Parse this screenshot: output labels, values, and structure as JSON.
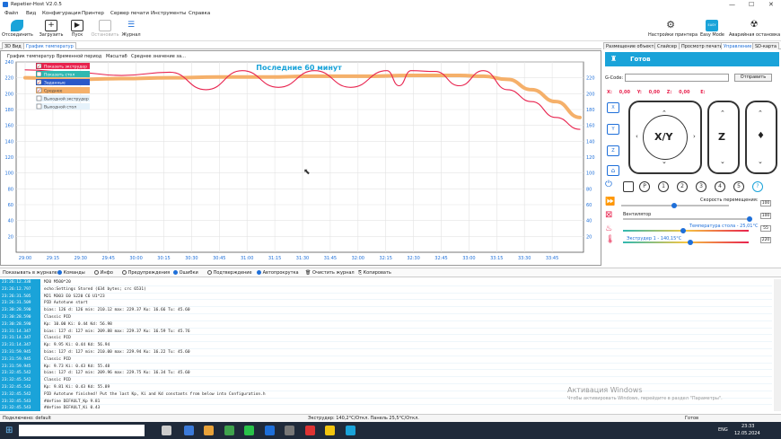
{
  "window": {
    "title": "Repetier-Host V2.0.5"
  },
  "menu": [
    "Файл",
    "Вид",
    "Конфигурация",
    "Принтер",
    "Сервер печати",
    "Инструменты",
    "Справка"
  ],
  "toolbar": {
    "left": [
      "Отсоединить",
      "Загрузить",
      "Пуск",
      "Остановить",
      "Журнал"
    ],
    "right": [
      "Настройки принтера",
      "Easy Mode",
      "Аварийная остановка"
    ],
    "easy_badge": "EASY"
  },
  "view_tabs": [
    "3D Вид",
    "График температур"
  ],
  "chart_toolbar": [
    "График температур",
    "Временной период",
    "Масштаб",
    "Среднее значение за..."
  ],
  "right_tabs": [
    "Размещение объекта",
    "Слайсер",
    "Просмотр печати",
    "Управление",
    "SD-карта"
  ],
  "chart_data": {
    "type": "line",
    "title": "Последние 60 минут",
    "x_ticks": [
      "29:00",
      "29:15",
      "29:30",
      "29:45",
      "30:00",
      "30:15",
      "30:30",
      "30:45",
      "31:00",
      "31:15",
      "31:30",
      "31:45",
      "32:00",
      "32:15",
      "32:30",
      "32:45",
      "33:00",
      "33:15",
      "33:30",
      "33:45"
    ],
    "y_ticks_left": [
      "240",
      "220",
      "200",
      "180",
      "160",
      "140",
      "120",
      "100",
      "80",
      "60",
      "40",
      "20"
    ],
    "y_ticks_right": [
      "220",
      "200",
      "180",
      "160",
      "140",
      "120",
      "100",
      "80",
      "60",
      "40",
      "20"
    ],
    "ylim": [
      0,
      240
    ],
    "grid": true,
    "legend_placement": "top-left",
    "legend": [
      "Показать экструдер",
      "Показать стол",
      "Заданные",
      "Среднее",
      "Выходной экструдер",
      "Выходной стол"
    ],
    "series": [
      {
        "name": "Экструдер",
        "color": "#e8234e",
        "x": [
          0,
          2,
          4,
          6,
          7.5,
          9,
          10.5,
          12,
          13.5,
          15,
          15.5,
          16,
          17,
          18,
          19,
          20,
          21,
          22,
          23
        ],
        "y": [
          230,
          227,
          223,
          227,
          205,
          229,
          208,
          229,
          208,
          229,
          210,
          229,
          228,
          210,
          229,
          205,
          190,
          170,
          155
        ]
      },
      {
        "name": "Среднее",
        "color": "#f5b06a",
        "x": [
          0,
          2,
          4,
          6,
          8,
          10,
          12,
          14,
          16,
          18,
          19,
          20,
          21,
          22,
          23
        ],
        "y": [
          220,
          218,
          219,
          220,
          221,
          221,
          222,
          222,
          223,
          223,
          222,
          218,
          205,
          190,
          170
        ]
      }
    ]
  },
  "control": {
    "status": "Готов",
    "gcode_label": "G-Code:",
    "send_button": "Отправить",
    "coords": {
      "x_label": "X:",
      "x": "0,00",
      "y_label": "Y:",
      "y": "0,00",
      "z_label": "Z:",
      "z": "0,00",
      "e_label": "E:"
    },
    "jog": {
      "xy": "X/Y",
      "z": "Z"
    },
    "home_buttons": [
      "X",
      "Y",
      "Z"
    ],
    "extruder_buttons": [
      "P",
      "1",
      "2",
      "3",
      "4",
      "5",
      "?"
    ],
    "speed_label": "Скорость перемещения:",
    "speed_value": "100",
    "fan_label": "Вентилятор",
    "fan_value": "100",
    "bed_label": "Температура стола - 25,01°С",
    "bed_value": "55",
    "extruder_label": "Экструдер 1 - 140,15°С",
    "extruder_value": "220"
  },
  "logbar": {
    "label": "Показывать в журнале:",
    "items": [
      "Команды",
      "Инфо",
      "Предупреждения",
      "Ошибки",
      "Подтверждение",
      "Автопрокрутка",
      "Очистить журнал",
      "Копировать"
    ]
  },
  "log": [
    {
      "t": "23:26:12.338",
      "m": "M20 M500*20"
    },
    {
      "t": "23:26:12.797",
      "m": "echo:Settings Stored (634 bytes; crc 6531)"
    },
    {
      "t": "23:26:31.505",
      "m": "M21 M303 E0 S220 C6 U1*23"
    },
    {
      "t": "23:26:31.509",
      "m": "PID Autotune start"
    },
    {
      "t": "23:30:28.590",
      "m": "bias: 126 d: 126 min: 210.12 max: 229.37 Ku: 16.66 Tu: 45.60"
    },
    {
      "t": "23:30:28.590",
      "m": "Classic PID"
    },
    {
      "t": "23:30:28.590",
      "m": "Kp: 10.00 Ki: 0.44 Kd: 56.98"
    },
    {
      "t": "23:31:14.347",
      "m": "bias: 127 d: 127 min: 209.88 max: 229.37 Ku: 16.59 Tu: 45.76"
    },
    {
      "t": "23:31:14.347",
      "m": "Classic PID"
    },
    {
      "t": "23:31:14.347",
      "m": "Kp: 9.95 Ki: 0.44 Kd: 56.94"
    },
    {
      "t": "23:31:59.945",
      "m": "bias: 127 d: 127 min: 210.00 max: 229.94 Ku: 16.22 Tu: 45.60"
    },
    {
      "t": "23:31:59.945",
      "m": "Classic PID"
    },
    {
      "t": "23:31:59.945",
      "m": "Kp: 9.73 Ki: 0.43 Kd: 55.48"
    },
    {
      "t": "23:32:45.542",
      "m": "bias: 127 d: 127 min: 209.96 max: 229.75 Ku: 16.34 Tu: 45.60"
    },
    {
      "t": "23:32:45.542",
      "m": "Classic PID"
    },
    {
      "t": "23:32:45.542",
      "m": "Kp: 9.81 Ki: 0.43 Kd: 55.89"
    },
    {
      "t": "23:32:45.542",
      "m": "PID Autotune finished! Put the last Kp, Ki and Kd constants from below into Configuration.h"
    },
    {
      "t": "23:32:45.543",
      "m": "#define DEFAULT_Kp 9.81"
    },
    {
      "t": "23:32:45.543",
      "m": "#define DEFAULT_Ki 0.43"
    },
    {
      "t": "23:32:45.543",
      "m": "#define DEFAULT_Kd 55.89"
    }
  ],
  "status": {
    "left": "Подключено: default",
    "center": "Экструдер: 140,2°С/Откл. Панель 25,5°С/Откл.",
    "right": "Готов"
  },
  "watermark": {
    "title": "Активация Windows",
    "sub": "Чтобы активировать Windows, перейдите в раздел \"Параметры\"."
  },
  "taskbar": {
    "time": "23:33",
    "date": "12.05.2024",
    "lang": "ENG"
  }
}
